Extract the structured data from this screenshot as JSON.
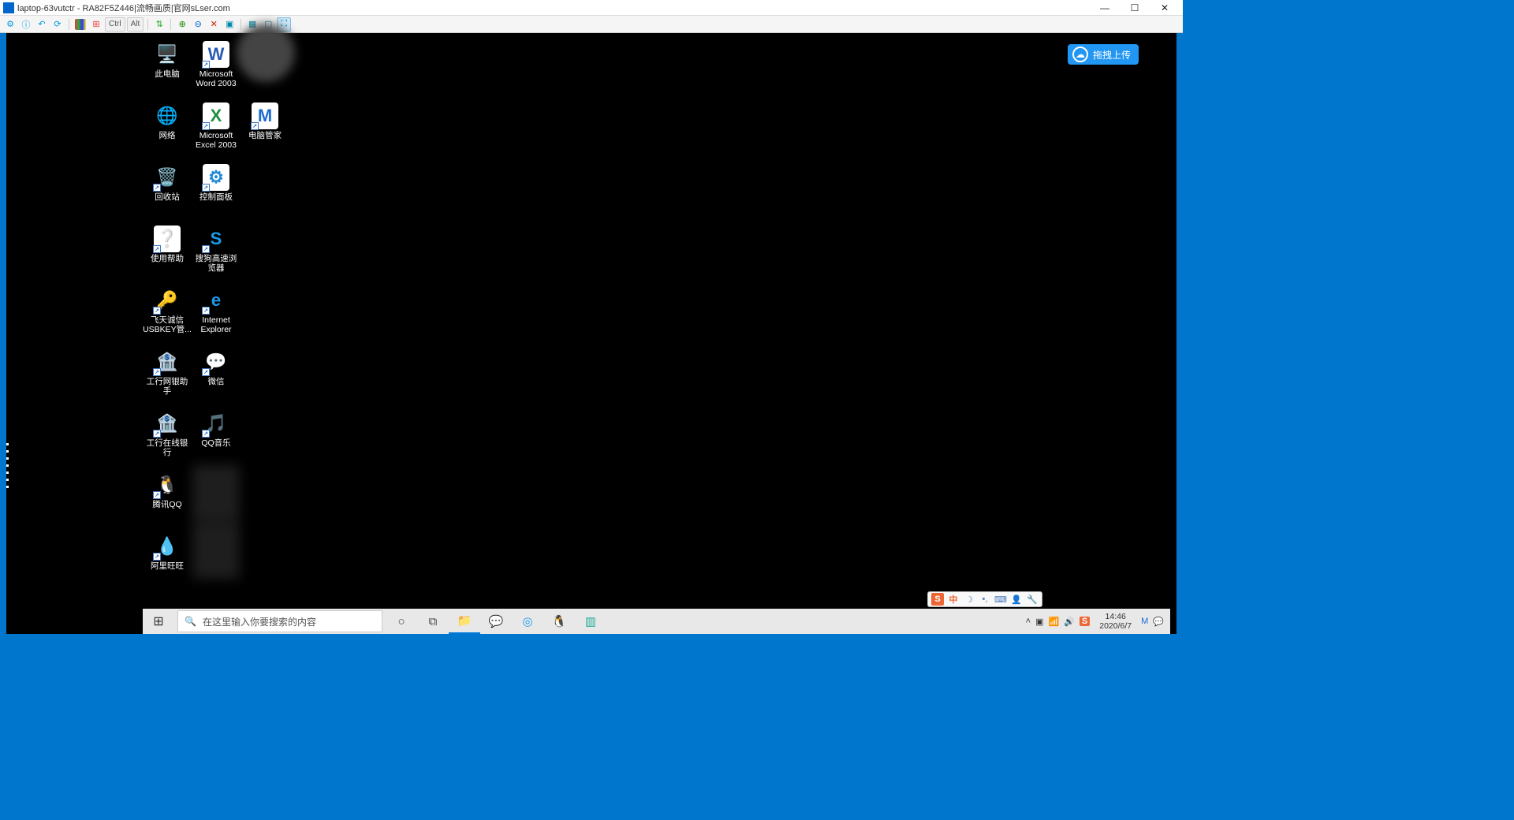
{
  "window": {
    "title": "laptop-63vutctr - RA82F5Z446|流畅画质|官网sLser.com"
  },
  "toolbar": {
    "ctrl": "Ctrl",
    "alt": "Alt"
  },
  "upload": {
    "label": "拖拽上传"
  },
  "desktop": {
    "col1": [
      {
        "label": "此电脑",
        "icon": "computer-icon",
        "color": "#3a8fd6"
      },
      {
        "label": "网络",
        "icon": "network-icon",
        "color": "#3a8fd6"
      },
      {
        "label": "回收站",
        "icon": "recycle-bin-icon",
        "color": "#5a6a7a"
      },
      {
        "label": "使用帮助",
        "icon": "help-icon",
        "color": "#ffffff"
      },
      {
        "label": "飞天诚信USBKEY管...",
        "icon": "usbkey-icon",
        "color": "#d02323"
      },
      {
        "label": "工行网银助手",
        "icon": "icbc-assistant-icon",
        "color": "#d02323"
      },
      {
        "label": "工行在线银行",
        "icon": "icbc-online-icon",
        "color": "#d02323"
      },
      {
        "label": "腾讯QQ",
        "icon": "qq-icon",
        "color": "#ffd400"
      },
      {
        "label": "阿里旺旺",
        "icon": "aliwangwang-icon",
        "color": "#1d9be8"
      }
    ],
    "col2": [
      {
        "label": "Microsoft Word 2003",
        "icon": "word-icon",
        "color": "#2a5ab4"
      },
      {
        "label": "Microsoft Excel 2003",
        "icon": "excel-icon",
        "color": "#1e8f3e"
      },
      {
        "label": "控制面板",
        "icon": "control-panel-icon",
        "color": "#2189d6"
      },
      {
        "label": "搜狗高速浏览器",
        "icon": "sogou-browser-icon",
        "color": "#1d9be8"
      },
      {
        "label": "Internet Explorer",
        "icon": "ie-icon",
        "color": "#1d9be8"
      },
      {
        "label": "微信",
        "icon": "wechat-icon",
        "color": "#2dc100"
      },
      {
        "label": "QQ音乐",
        "icon": "qqmusic-icon",
        "color": "#ffd400"
      }
    ],
    "col3": [
      {
        "label": "电脑管家",
        "icon": "pc-manager-icon",
        "color": "#1d6cd1"
      }
    ]
  },
  "ime": {
    "s": "S",
    "zhong": "中"
  },
  "taskbar": {
    "search_placeholder": "在这里输入你要搜索的内容",
    "clock_time": "14:46",
    "clock_date": "2020/6/7"
  }
}
